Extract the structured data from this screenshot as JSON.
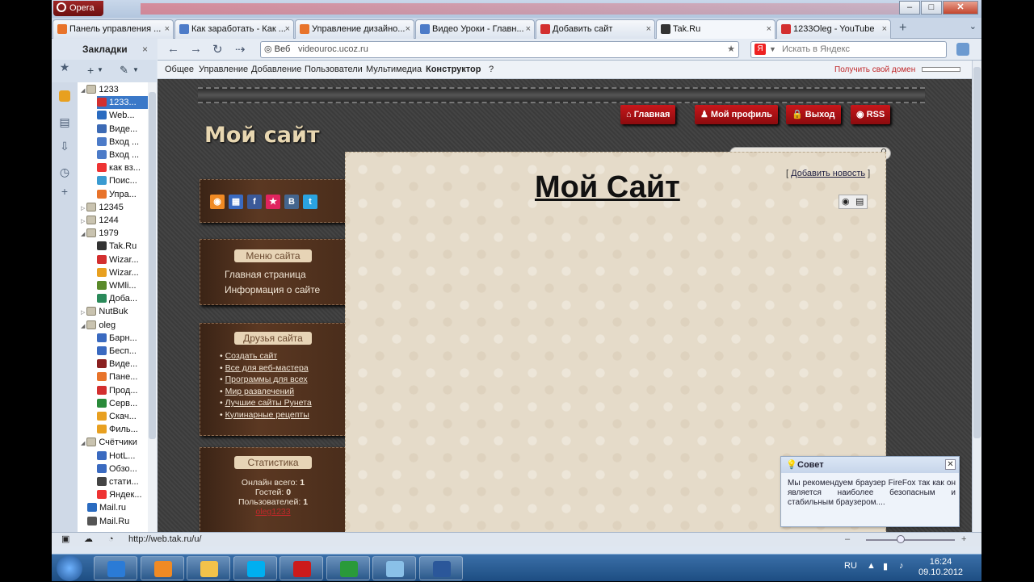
{
  "browser": {
    "app_name": "Opera",
    "tabs": [
      {
        "label": "Панель управления ...",
        "icon": "opera-icon",
        "color": "#e8732a"
      },
      {
        "label": "Как заработать - Как ...",
        "icon": "compass-icon",
        "color": "#4c7bc8"
      },
      {
        "label": "Управление дизайно...",
        "icon": "compass-icon",
        "color": "#e8732a"
      },
      {
        "label": "Видео Уроки - Главн...",
        "icon": "compass-icon",
        "color": "#4c7bc8"
      },
      {
        "label": "Добавить сайт",
        "icon": "dollar-icon",
        "color": "#d32f2f"
      },
      {
        "label": "Tak.Ru",
        "icon": "tak-icon",
        "color": "#333333"
      },
      {
        "label": "1233Oleg - YouTube",
        "icon": "youtube-icon",
        "color": "#d32f2f"
      }
    ],
    "address": {
      "prefix": "Веб",
      "url": "videouroc.ucoz.ru"
    },
    "search_placeholder": "Искать в Яндекс",
    "status_url": "http://web.tak.ru/u/"
  },
  "sidebar": {
    "title": "Закладки",
    "tree": [
      {
        "label": "1233",
        "type": "folder",
        "level": 0,
        "open": true
      },
      {
        "label": "1233...",
        "type": "item",
        "level": 1,
        "selected": true,
        "color": "#d32f2f"
      },
      {
        "label": "Web...",
        "type": "item",
        "level": 1,
        "color": "#2a6bc0"
      },
      {
        "label": "Виде...",
        "type": "item",
        "level": 1,
        "color": "#3c6ab5"
      },
      {
        "label": "Вход ...",
        "type": "item",
        "level": 1,
        "color": "#4c7bc8"
      },
      {
        "label": "Вход ...",
        "type": "item",
        "level": 1,
        "color": "#4c7bc8"
      },
      {
        "label": "как вз...",
        "type": "item",
        "level": 1,
        "color": "#e33"
      },
      {
        "label": "Поис...",
        "type": "item",
        "level": 1,
        "color": "#3a9bd1"
      },
      {
        "label": "Упра...",
        "type": "item",
        "level": 1,
        "color": "#e8732a"
      },
      {
        "label": "12345",
        "type": "folder",
        "level": 0,
        "open": false
      },
      {
        "label": "1244",
        "type": "folder",
        "level": 0,
        "open": false
      },
      {
        "label": "1979",
        "type": "folder",
        "level": 0,
        "open": true
      },
      {
        "label": "Tak.Ru",
        "type": "item",
        "level": 1,
        "color": "#333"
      },
      {
        "label": "Wizar...",
        "type": "item",
        "level": 1,
        "color": "#d32f2f"
      },
      {
        "label": "Wizar...",
        "type": "item",
        "level": 1,
        "color": "#e8a020"
      },
      {
        "label": "WMli...",
        "type": "item",
        "level": 1,
        "color": "#5a8a2a"
      },
      {
        "label": "Доба...",
        "type": "item",
        "level": 1,
        "color": "#2a8a5a"
      },
      {
        "label": "NutBuk",
        "type": "folder",
        "level": 0,
        "open": false
      },
      {
        "label": "oleg",
        "type": "folder",
        "level": 0,
        "open": true
      },
      {
        "label": "Барн...",
        "type": "item",
        "level": 1,
        "color": "#3a6ac0"
      },
      {
        "label": "Бесп...",
        "type": "item",
        "level": 1,
        "color": "#3a6ac0"
      },
      {
        "label": "Виде...",
        "type": "item",
        "level": 1,
        "color": "#8a2020"
      },
      {
        "label": "Пане...",
        "type": "item",
        "level": 1,
        "color": "#e8732a"
      },
      {
        "label": "Прод...",
        "type": "item",
        "level": 1,
        "color": "#d32f2f"
      },
      {
        "label": "Серв...",
        "type": "item",
        "level": 1,
        "color": "#2a8a3a"
      },
      {
        "label": "Скач...",
        "type": "item",
        "level": 1,
        "color": "#e8a020"
      },
      {
        "label": "Филь...",
        "type": "item",
        "level": 1,
        "color": "#e8a020"
      },
      {
        "label": "Счётчики",
        "type": "folder",
        "level": 0,
        "open": true
      },
      {
        "label": "HotL...",
        "type": "item",
        "level": 1,
        "color": "#3a6ac0"
      },
      {
        "label": "Обзо...",
        "type": "item",
        "level": 1,
        "color": "#3a6ac0"
      },
      {
        "label": "стати...",
        "type": "item",
        "level": 1,
        "color": "#444"
      },
      {
        "label": "Яндек...",
        "type": "item",
        "level": 1,
        "color": "#e33"
      },
      {
        "label": "Mail.ru",
        "type": "item",
        "level": 0,
        "color": "#2a6bc0"
      },
      {
        "label": "Mail.Ru",
        "type": "item",
        "level": 0,
        "color": "#555"
      }
    ]
  },
  "ucoz_bar": {
    "menu": [
      "Общее",
      "Управление",
      "Добавление",
      "Пользователи",
      "Мультимедиа",
      "Конструктор",
      "?"
    ],
    "domain_link": "Получить свой домен"
  },
  "site": {
    "title": "Мой сайт",
    "nav": [
      {
        "label": "Главная",
        "icon": "home-icon"
      },
      {
        "label": "Мой профиль",
        "icon": "user-icon"
      },
      {
        "label": "Выход",
        "icon": "lock-icon"
      },
      {
        "label": "RSS",
        "icon": "rss-icon"
      }
    ],
    "social": [
      {
        "name": "rss-icon",
        "glyph": "◉",
        "color": "#f08a24"
      },
      {
        "name": "delicious-icon",
        "glyph": "▦",
        "color": "#3a6ac0"
      },
      {
        "name": "facebook-icon",
        "glyph": "f",
        "color": "#3b5998"
      },
      {
        "name": "bookmark-icon",
        "glyph": "★",
        "color": "#e0245e"
      },
      {
        "name": "vk-icon",
        "glyph": "В",
        "color": "#45668e"
      },
      {
        "name": "twitter-icon",
        "glyph": "t",
        "color": "#2aa3e0"
      }
    ],
    "menu_block": {
      "title": "Меню сайта",
      "items": [
        "Главная страница",
        "Информация о сайте"
      ]
    },
    "friends_block": {
      "title": "Друзья сайта",
      "links": [
        "Создать сайт",
        "Все для веб-мастера",
        "Программы для всех",
        "Мир развлечений",
        "Лучшие сайты Рунета",
        "Кулинарные рецепты"
      ]
    },
    "stats_block": {
      "title": "Статистика",
      "online": "Онлайн всего: ",
      "online_val": "1",
      "guests": "Гостей: ",
      "guests_val": "0",
      "users": "Пользователей: ",
      "users_val": "1",
      "user_name": "oleg1233"
    },
    "page_heading": "Мой Сайт",
    "add_news": "Добавить новость"
  },
  "tip": {
    "title": "Совет",
    "text": "Мы рекомендуем браузер FireFox так как он является наиболее безопасным и стабильным браузером...."
  },
  "taskbar": {
    "apps": [
      {
        "name": "ie-icon",
        "color": "#2b7bd6"
      },
      {
        "name": "media-player-icon",
        "color": "#f08a24"
      },
      {
        "name": "explorer-icon",
        "color": "#f2c24a"
      },
      {
        "name": "skype-icon",
        "color": "#00aff0"
      },
      {
        "name": "opera-icon",
        "color": "#cc1b1b"
      },
      {
        "name": "camtasia-icon",
        "color": "#2a9a3a"
      },
      {
        "name": "notepad-icon",
        "color": "#8ac0e8"
      },
      {
        "name": "word-icon",
        "color": "#2b579a"
      }
    ],
    "lang": "RU",
    "time": "16:24",
    "date": "09.10.2012"
  }
}
